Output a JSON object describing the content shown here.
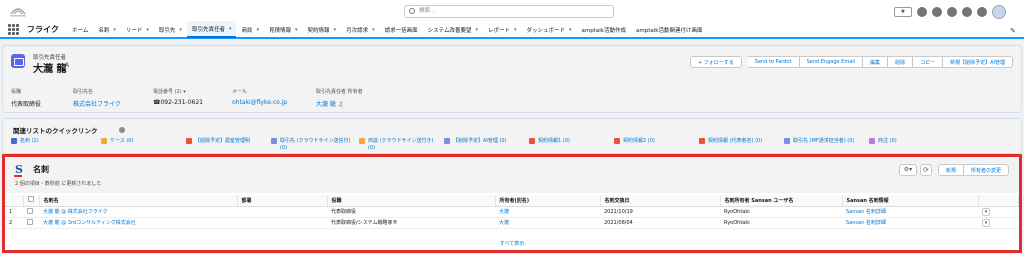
{
  "global": {
    "search_placeholder": "検索...",
    "favorites_label": "★"
  },
  "nav": {
    "app_name": "フライク",
    "tabs": [
      {
        "label": "ホーム",
        "chevron": false
      },
      {
        "label": "名刺",
        "chevron": true
      },
      {
        "label": "リード",
        "chevron": true
      },
      {
        "label": "取引先",
        "chevron": true
      },
      {
        "label": "取引先責任者",
        "chevron": true,
        "active": true
      },
      {
        "label": "商談",
        "chevron": true
      },
      {
        "label": "見積情報",
        "chevron": true
      },
      {
        "label": "契約情報",
        "chevron": true
      },
      {
        "label": "月次請求",
        "chevron": true
      },
      {
        "label": "請求一括画面",
        "chevron": false
      },
      {
        "label": "システム改善要望",
        "chevron": true
      },
      {
        "label": "レポート",
        "chevron": true
      },
      {
        "label": "ダッシュボード",
        "chevron": true
      },
      {
        "label": "amptalk活動作成",
        "chevron": false
      },
      {
        "label": "amptalk活動関連付け画面",
        "chevron": false
      }
    ]
  },
  "record": {
    "object_label": "取引先責任者",
    "name": "大瀧 龍",
    "name_suffix": "A",
    "follow_label": "+ フォローする",
    "actions": [
      "Send to Pardot",
      "Send Engage Email",
      "編集",
      "削除",
      "コピー",
      "新規【削除予定】AI管理"
    ],
    "fields": [
      {
        "label": "役職",
        "value": "代表取締役",
        "link": false
      },
      {
        "label": "取引先名",
        "value": "株式会社フライク",
        "link": true
      },
      {
        "label": "電話番号 (2) ▾",
        "value": "☎092-231-0621",
        "link": false
      },
      {
        "label": "メール",
        "value": "ohtaki@flyke.co.jp",
        "link": true
      },
      {
        "label": "取引先責任者 所有者",
        "value": "大瀧 龍 ♫",
        "link": true
      }
    ]
  },
  "quick_links": {
    "title": "関連リストのクイックリンク",
    "items": [
      {
        "label": "名刺 (2)",
        "color": "#3a6fd1"
      },
      {
        "label": "ケース (0)",
        "color": "#f2a93b"
      },
      {
        "label": "【削除予定】農産管理明",
        "color": "#e0583a"
      },
      {
        "label": "取引先 (クラウドサイン送信付) (0)",
        "color": "#7f8de1"
      },
      {
        "label": "商談 (クラウドサイン送付き) (0)",
        "color": "#f2a93b"
      },
      {
        "label": "【削除予定】AI管理 (0)",
        "color": "#7f8de1"
      },
      {
        "label": "契約情報1 (0)",
        "color": "#e0583a"
      },
      {
        "label": "契約情報2 (0)",
        "color": "#e0583a"
      },
      {
        "label": "契約情報 (代表者名) (0)",
        "color": "#e0583a"
      },
      {
        "label": "取引先 (MF請求担当者) (0)",
        "color": "#7f8de1"
      },
      {
        "label": "商注 (0)",
        "color": "#b07fe1"
      }
    ]
  },
  "related": {
    "title": "名刺",
    "meta": "2 個の項目・数秒前 に更新されました",
    "buttons": {
      "new": "新規",
      "change_owner": "所有者の変更"
    },
    "columns": [
      "",
      "",
      "名刺名",
      "部署",
      "役職",
      "所有者(別名)",
      "名刺交換日",
      "名刺所有者 Sansan ユーザ名",
      "Sansan 名刺情報",
      ""
    ],
    "rows": [
      {
        "num": "1",
        "name": "大瀧 龍 @ 株式会社フライク",
        "dept": "",
        "title": "代表取締役",
        "owner": "大瀧",
        "date": "2021/10/19",
        "sansan_user": "RyoOhtaki",
        "info": "Sansan 名刺詳細"
      },
      {
        "num": "2",
        "name": "大瀧 龍 @ 3rdコンサルティング株式会社",
        "dept": "",
        "title": "代表取締役/システム戦略家®",
        "owner": "大瀧",
        "date": "2021/08/04",
        "sansan_user": "RyoOhtaki",
        "info": "Sansan 名刺詳細"
      }
    ],
    "view_all": "すべて表示"
  }
}
